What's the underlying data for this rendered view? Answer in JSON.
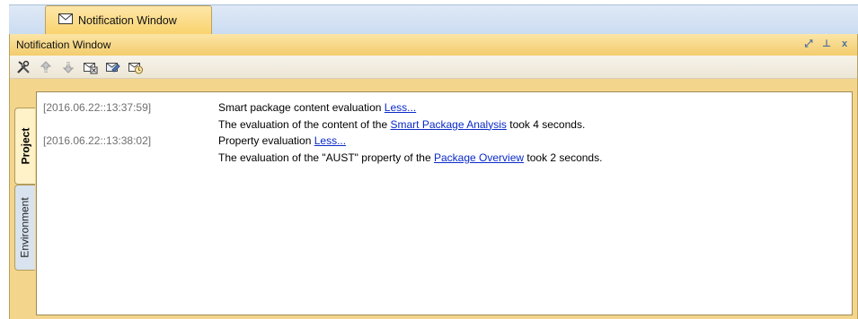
{
  "tab": {
    "label": "Notification Window",
    "icon": "envelope-icon"
  },
  "window": {
    "title": "Notification Window",
    "controls": [
      {
        "name": "restore",
        "glyph": "⤢"
      },
      {
        "name": "pin",
        "glyph": "⊥"
      },
      {
        "name": "close",
        "glyph": "x"
      }
    ]
  },
  "toolbar": {
    "buttons": [
      {
        "name": "options",
        "icon": "tools-icon"
      },
      {
        "name": "previous",
        "icon": "arrow-up-icon"
      },
      {
        "name": "next",
        "icon": "arrow-down-icon"
      },
      {
        "name": "clear",
        "icon": "clear-messages-icon"
      },
      {
        "name": "show-details",
        "icon": "message-details-icon"
      },
      {
        "name": "history",
        "icon": "message-history-icon"
      }
    ]
  },
  "side_tabs": {
    "project": "Project",
    "environment": "Environment"
  },
  "notifications": [
    {
      "timestamp": "[2016.06.22::13:37:59]",
      "summary": "Smart package content evaluation",
      "toggle": "Less...",
      "detail_before": "The evaluation of the content of the",
      "detail_link": "Smart Package Analysis",
      "detail_after": "took 4 seconds."
    },
    {
      "timestamp": "[2016.06.22::13:38:02]",
      "summary": "Property evaluation",
      "toggle": "Less...",
      "detail_before": "The evaluation of the \"AUST\" property of the",
      "detail_link": "Package Overview",
      "detail_after": "took 2 seconds."
    }
  ]
}
